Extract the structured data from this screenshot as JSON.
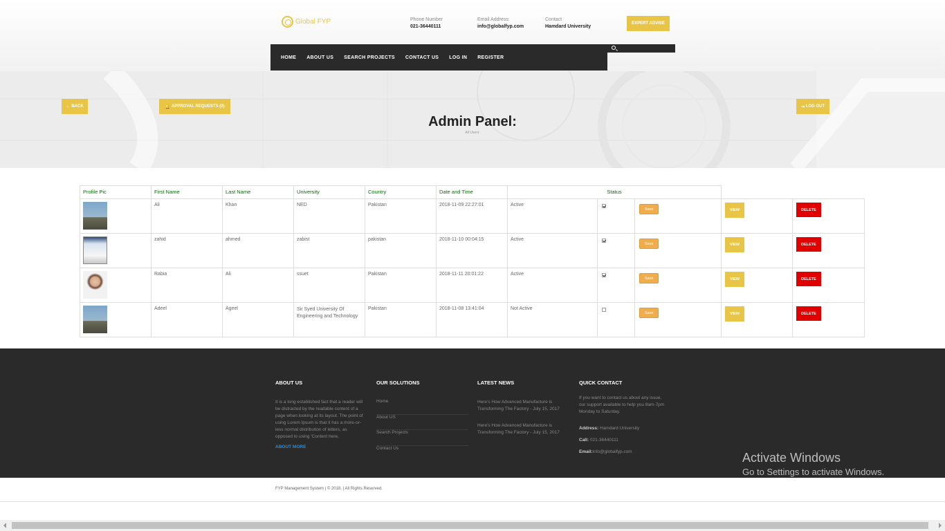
{
  "header": {
    "logo_text": "Global FYP",
    "phone_label": "Phone Number",
    "phone": "021-36440111",
    "email_label": "Email Address:",
    "email": "info@globalfyp.com",
    "contact_label": "Contact",
    "contact": "Hamdard University",
    "expert_button": "EXPERT ADVISE"
  },
  "nav": {
    "items": [
      "HOME",
      "ABOUT US",
      "SEARCH PROJECTS",
      "CONTACT US",
      "LOG IN",
      "REGISTER"
    ]
  },
  "banner": {
    "back": "BACK",
    "approval": "APPROVAL REQUESTS (0)",
    "logout": "LOG OUT",
    "title": "Admin Panel:",
    "subtitle": "All Users:"
  },
  "table": {
    "headers": [
      "Profile Pic",
      "First Name",
      "Last Name",
      "University",
      "Country",
      "Date and Time",
      "Status"
    ],
    "save_label": "Save",
    "view_label": "VIEW",
    "delete_label": "DELETE",
    "rows": [
      {
        "first": "Ali",
        "last": "Khan",
        "university": "NED",
        "country": "Pakistan",
        "datetime": "2018-11-09 22:27:01",
        "status": "Active",
        "checked": true
      },
      {
        "first": "zahid",
        "last": "ahmed",
        "university": "zabist",
        "country": "pakistan",
        "datetime": "2018-11-10 00:04:15",
        "status": "Active",
        "checked": true
      },
      {
        "first": "Rabia",
        "last": "Ali",
        "university": "ssuet",
        "country": "Pakistan",
        "datetime": "2018-11-11 20:01:22",
        "status": "Active",
        "checked": true
      },
      {
        "first": "Adeel",
        "last": "Ageel",
        "university": "Sir Syed University Of Engineering and Technology",
        "country": "Pakistan",
        "datetime": "2018-11-08 13:41:04",
        "status": "Not Active",
        "checked": false
      }
    ]
  },
  "footer": {
    "about_title": "ABOUT US",
    "about_text": "It is a long established fact that a reader will be distracted by the readable content of a page when looking at its layout. The point of using Lorem Ipsum is that it has a more-or-less normal distribution of letters, as opposed to using 'Content here,",
    "about_more": "ABOUT MORE",
    "solutions_title": "OUR SOLUTIONS",
    "solutions": [
      "Home",
      "About US",
      "Search Projects",
      "Contact Us"
    ],
    "news_title": "LATEST NEWS",
    "news": [
      "Here's How Advanced Manufacture is Transforming The Factory - July 15, 2017",
      "Here's How Advanced Manufacture is Transforming The Factory - July 15, 2017"
    ],
    "contact_title": "QUICK CONTACT",
    "contact_text": "If you want to contact us about any issue, our support available to help you 8am-7pm Monday to Saturday.",
    "address_label": "Address:",
    "address": "Hamdard University",
    "call_label": "Call:",
    "call": "021-36440111",
    "email_label": "Email:",
    "email": "info@globalfyp.com"
  },
  "copyright": "FYP Management System | © 2018. | All Rights Reserved.",
  "watermark": {
    "line1": "Activate Windows",
    "line2": "Go to Settings to activate Windows."
  }
}
